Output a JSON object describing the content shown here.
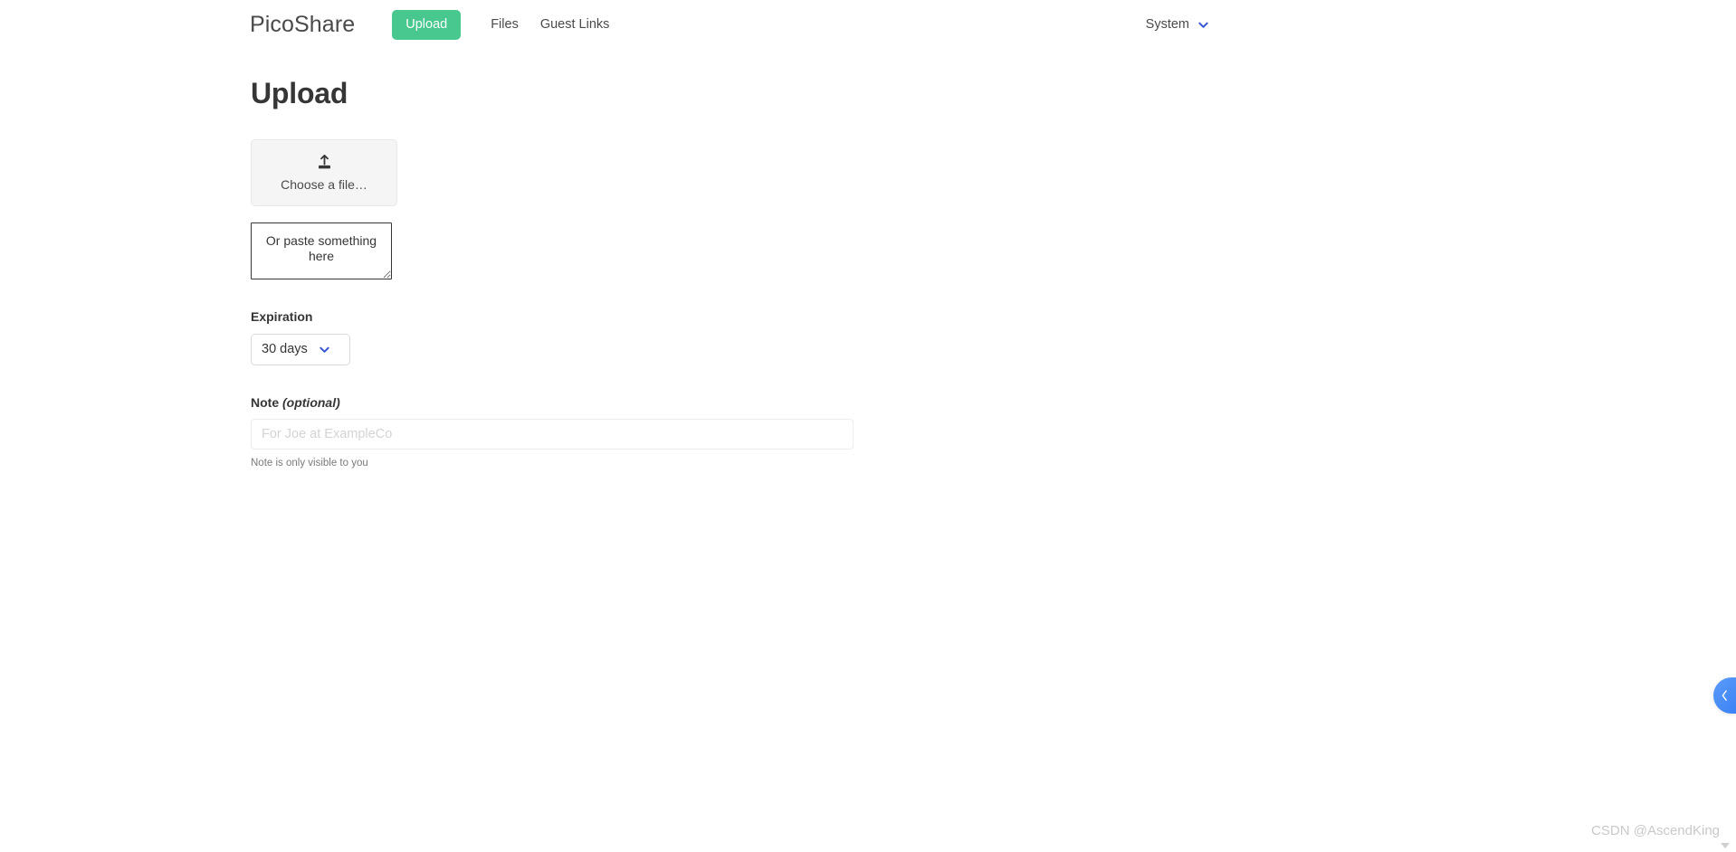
{
  "navbar": {
    "brand": "PicoShare",
    "upload_button": "Upload",
    "links": [
      {
        "label": "Files"
      },
      {
        "label": "Guest Links"
      }
    ],
    "system_menu": {
      "label": "System",
      "chevron_icon": "chevron-down-icon",
      "chevron_color": "#3454d1"
    }
  },
  "page": {
    "title": "Upload"
  },
  "upload": {
    "file_picker": {
      "icon": "upload-tray-icon",
      "label": "Choose a file…"
    },
    "paste_area": {
      "placeholder": "Or paste something here",
      "value": ""
    },
    "expiration": {
      "label": "Expiration",
      "selected": "30 days",
      "chevron_icon": "chevron-down-icon",
      "options": [
        "30 days"
      ]
    },
    "note": {
      "label": "Note ",
      "label_optional": "(optional)",
      "placeholder": "For Joe at ExampleCo",
      "value": "",
      "help": "Note is only visible to you"
    }
  },
  "side_tab": {
    "icon": "chevron-left-icon",
    "color": "#3b82f6"
  },
  "watermark": {
    "text": "CSDN @AscendKing"
  },
  "colors": {
    "brand_green": "#48c78e",
    "text_dark": "#363636",
    "text_body": "#4a4a4a",
    "link_blue": "#3454d1",
    "border_light": "#dbdbdb",
    "panel_bg": "#f5f5f5"
  }
}
